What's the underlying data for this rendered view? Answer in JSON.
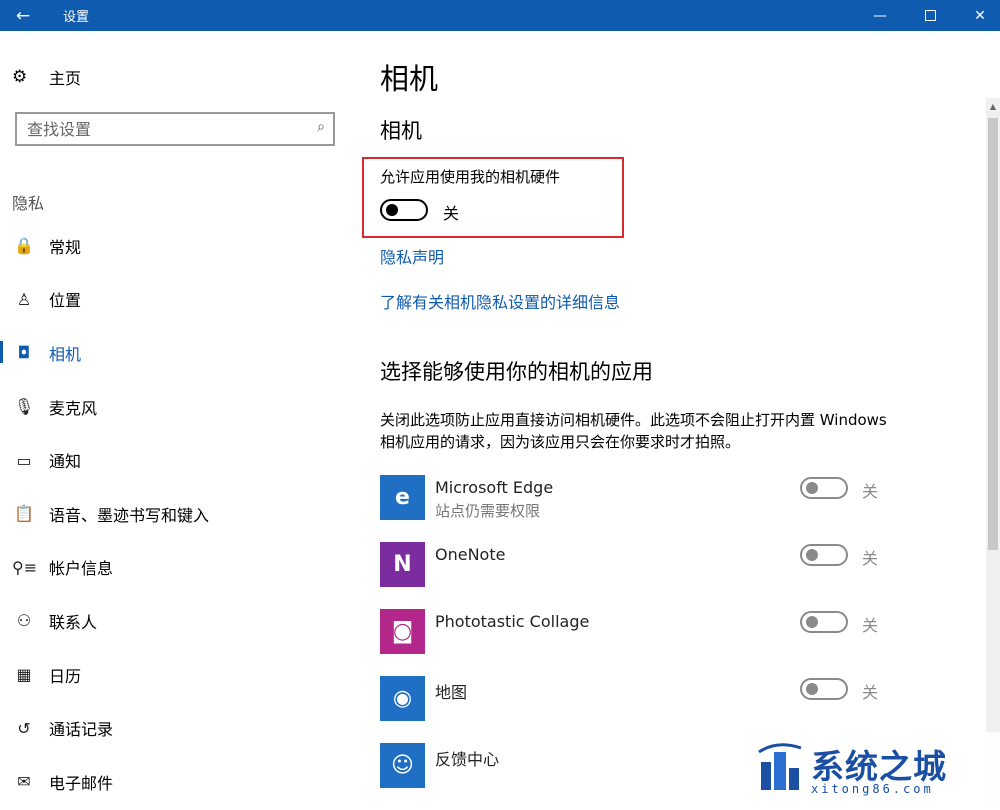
{
  "window": {
    "title": "设置",
    "back_glyph": "←",
    "min_glyph": "—",
    "close_glyph": "✕"
  },
  "sidebar": {
    "home_label": "主页",
    "search_placeholder": "查找设置",
    "group_label": "隐私",
    "items": [
      {
        "label": "常规",
        "icon": "lock-icon",
        "glyph": "🔒"
      },
      {
        "label": "位置",
        "icon": "location-person-icon",
        "glyph": "♙"
      },
      {
        "label": "相机",
        "icon": "camera-icon",
        "glyph": "◘",
        "active": true
      },
      {
        "label": "麦克风",
        "icon": "microphone-icon",
        "glyph": "🎙"
      },
      {
        "label": "通知",
        "icon": "notification-icon",
        "glyph": "▭"
      },
      {
        "label": "语音、墨迹书写和键入",
        "icon": "clipboard-icon",
        "glyph": "📋"
      },
      {
        "label": "帐户信息",
        "icon": "account-info-icon",
        "glyph": "⚲≡"
      },
      {
        "label": "联系人",
        "icon": "contacts-icon",
        "glyph": "⚇"
      },
      {
        "label": "日历",
        "icon": "calendar-icon",
        "glyph": "▦"
      },
      {
        "label": "通话记录",
        "icon": "call-history-icon",
        "glyph": "↺"
      },
      {
        "label": "电子邮件",
        "icon": "mail-icon",
        "glyph": "✉"
      }
    ]
  },
  "main": {
    "page_title": "相机",
    "section_title": "相机",
    "master_toggle": {
      "label": "允许应用使用我的相机硬件",
      "state": "关",
      "on": false
    },
    "privacy_link": "隐私声明",
    "details_link": "了解有关相机隐私设置的详细信息",
    "apps_title": "选择能够使用你的相机的应用",
    "apps_desc": "关闭此选项防止应用直接访问相机硬件。此选项不会阻止打开内置 Windows 相机应用的请求，因为该应用只会在你要求时才拍照。",
    "apps": [
      {
        "name": "Microsoft Edge",
        "sub": "站点仍需要权限",
        "state": "关",
        "icon": "edge-icon",
        "color": "#1f6fc5",
        "glyph": "e"
      },
      {
        "name": "OneNote",
        "sub": "",
        "state": "关",
        "icon": "onenote-icon",
        "color": "#7b2da0",
        "glyph": "N"
      },
      {
        "name": "Phototastic Collage",
        "sub": "",
        "state": "关",
        "icon": "phototastic-icon",
        "color": "#b3278a",
        "glyph": "◙"
      },
      {
        "name": "地图",
        "sub": "",
        "state": "关",
        "icon": "maps-icon",
        "color": "#1f6fc5",
        "glyph": "◉"
      },
      {
        "name": "反馈中心",
        "sub": "",
        "state": "",
        "icon": "feedback-hub-icon",
        "color": "#1f6fc5",
        "glyph": "☺"
      }
    ]
  },
  "watermark": {
    "title": "系统之城",
    "url": "xitong86.com"
  },
  "colors": {
    "accent": "#0f5bb0",
    "highlight_border": "#d9282f"
  }
}
